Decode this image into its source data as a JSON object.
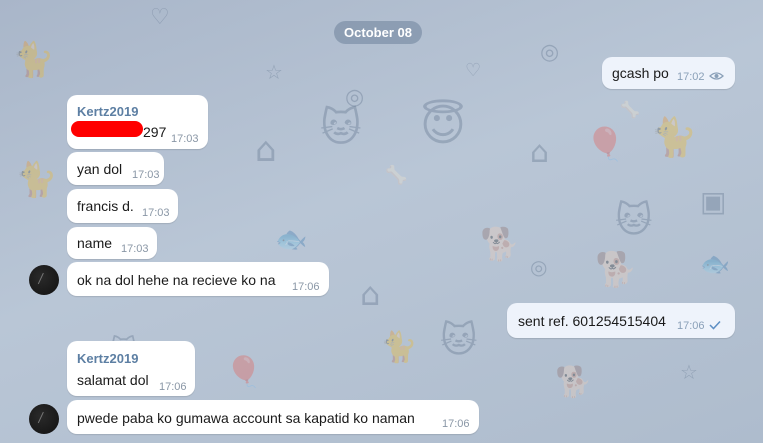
{
  "date_divider": "October 08",
  "messages": {
    "m1": {
      "text": "gcash po",
      "time": "17:02",
      "status_icon": "eye-icon"
    },
    "m2": {
      "sender": "Kertz2019",
      "text_visible_suffix": "297",
      "time": "17:03"
    },
    "m3": {
      "text": "yan dol",
      "time": "17:03"
    },
    "m4": {
      "text": "francis d.",
      "time": "17:03"
    },
    "m5": {
      "text": "name",
      "time": "17:03"
    },
    "m6": {
      "text": "ok na dol hehe na recieve ko na",
      "time": "17:06"
    },
    "m7": {
      "text": "sent ref. 601254515404",
      "time": "17:06",
      "status_icon": "check-icon"
    },
    "m8": {
      "sender": "Kertz2019",
      "text": "salamat dol",
      "time": "17:06"
    },
    "m9": {
      "text": "pwede paba ko gumawa account sa kapatid ko naman",
      "time": "17:06"
    }
  },
  "colors": {
    "incoming_bubble": "#ffffff",
    "outgoing_bubble": "#eef3fb",
    "sender_name": "#5d7fa3",
    "redaction": "#ff0000",
    "wallpaper": "#b4c1d2"
  }
}
